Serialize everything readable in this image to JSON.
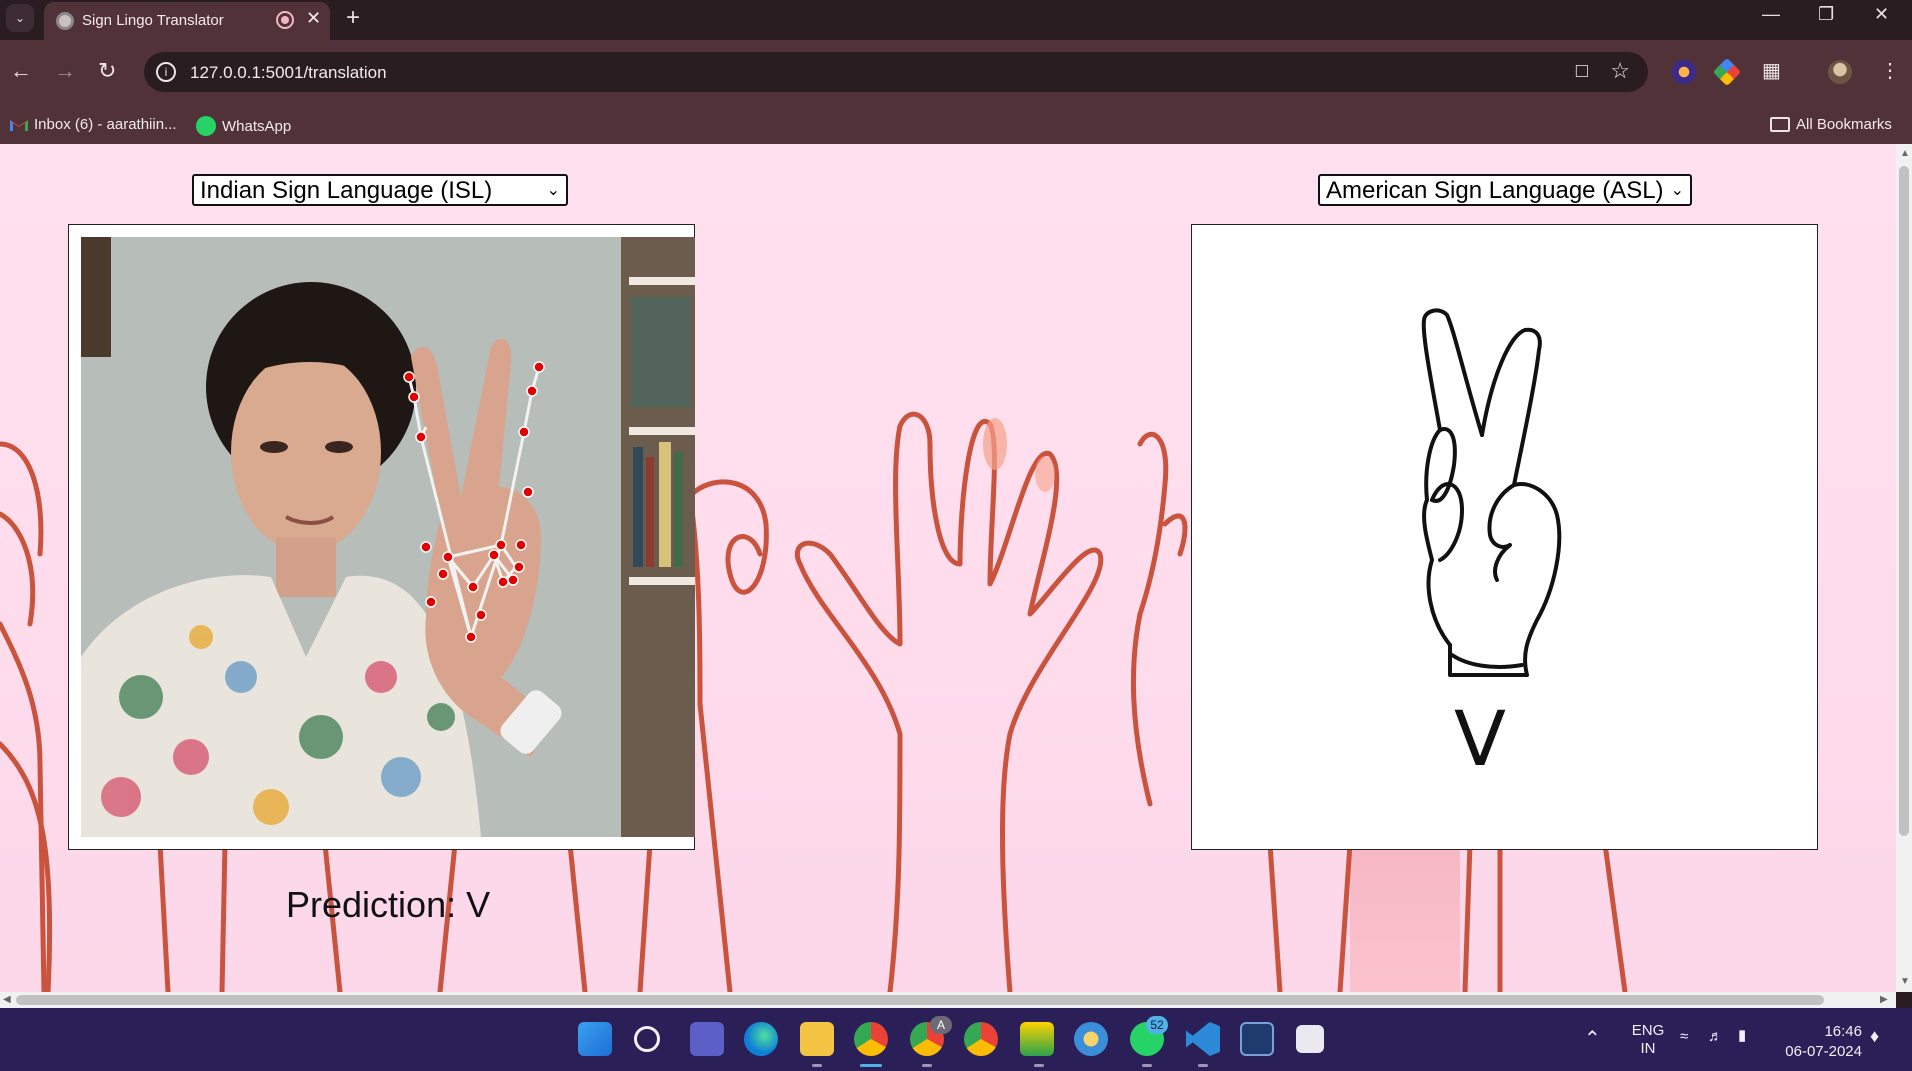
{
  "browser": {
    "tab_title": "Sign Lingo Translator",
    "url": "127.0.0.1:5001/translation",
    "bookmarks": [
      {
        "label": "Inbox (6) - aarathiin..."
      },
      {
        "label": "WhatsApp"
      }
    ],
    "all_bookmarks_label": "All Bookmarks"
  },
  "page": {
    "source_language": {
      "selected": "Indian Sign Language (ISL)"
    },
    "target_language": {
      "selected": "American Sign Language (ASL)"
    },
    "prediction_label": "Prediction:",
    "prediction_value": "V",
    "output_letter": "V"
  },
  "taskbar": {
    "lang_top": "ENG",
    "lang_bottom": "IN",
    "time": "16:46",
    "date": "06-07-2024",
    "whatsapp_badge": "52",
    "chrome_profile_badge": "A"
  },
  "colors": {
    "page_bg": "#ffdcec",
    "hand_stroke": "#c9533d",
    "browser_frame": "#513238",
    "taskbar": "#2b1f58",
    "landmark": "#e00000"
  }
}
